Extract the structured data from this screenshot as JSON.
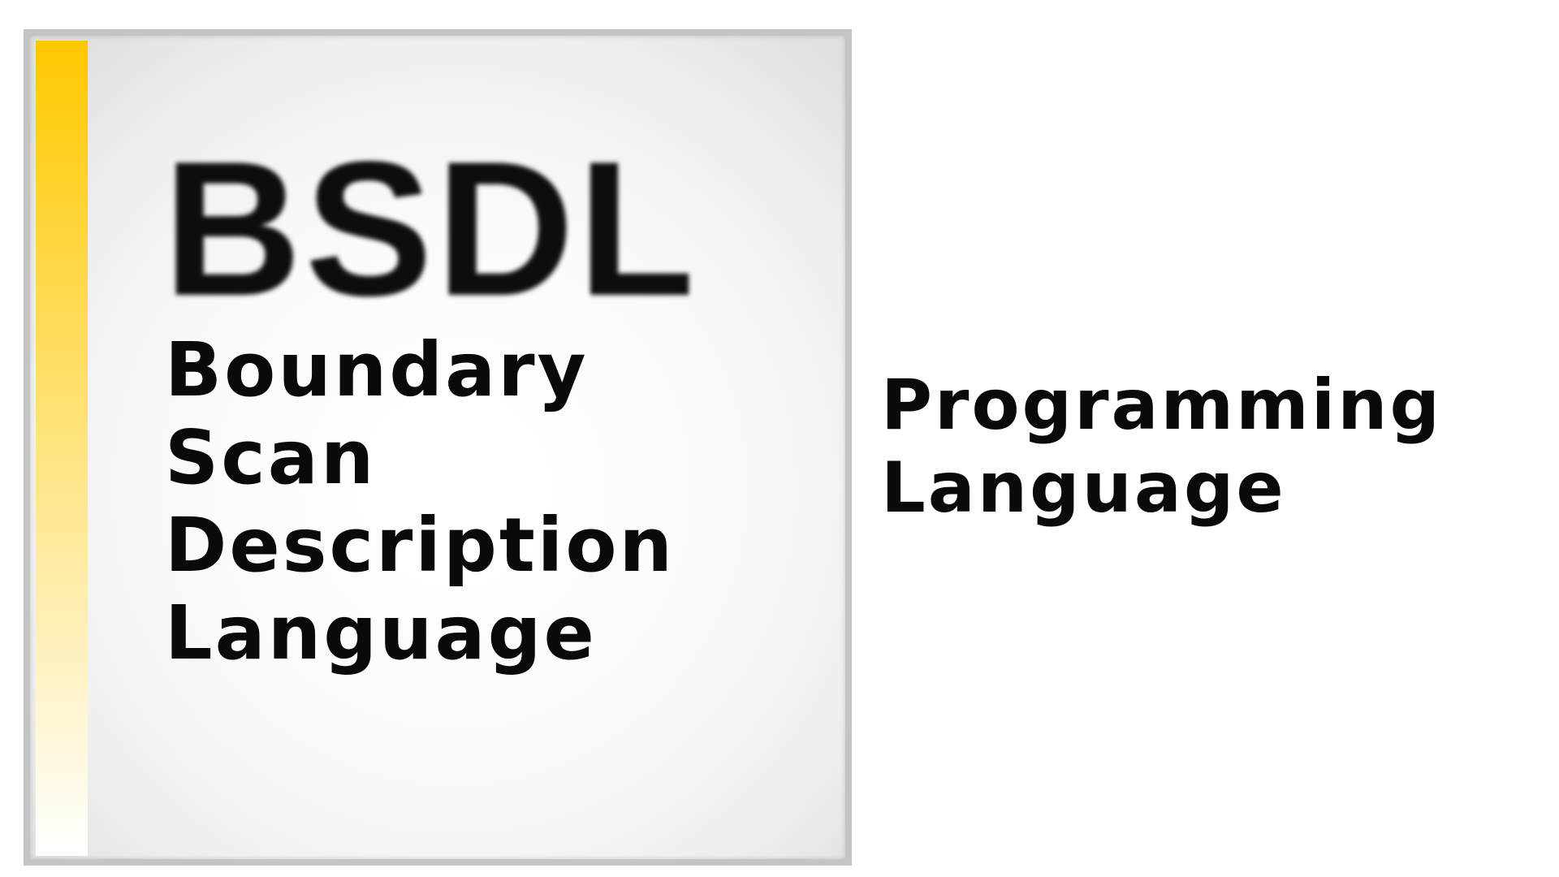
{
  "logo": {
    "abbreviation": "BSDL",
    "words": [
      "Boundary",
      "Scan",
      "Description",
      "Language"
    ],
    "accent_color_top": "#ffc800",
    "accent_color_bottom": "#ffffff"
  },
  "category": {
    "lines": [
      "Programming",
      "Language"
    ]
  }
}
